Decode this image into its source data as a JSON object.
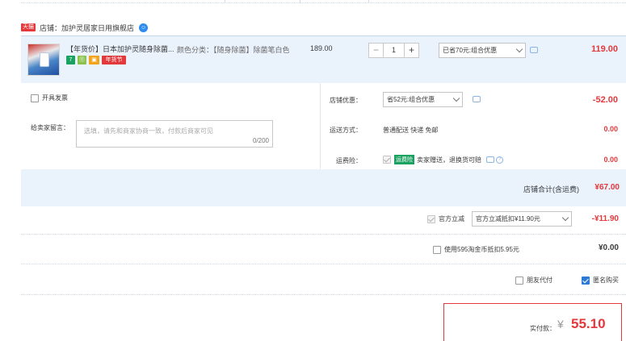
{
  "shop": {
    "tag": "天猫",
    "label": "店铺：加护灵居家日用旗舰店"
  },
  "item": {
    "title": "【年货价】日本加护灵随身除菌...",
    "icons": {
      "seven": "7",
      "leaf": "⑪",
      "card": "▣",
      "tag": "年货节"
    },
    "sku": "颜色分类：【随身除菌】除菌笔白色",
    "price": "189.00",
    "qty": "1",
    "minus": "−",
    "plus": "+",
    "discount_select": "已省70元:组合优惠",
    "total": "119.00"
  },
  "invoice": {
    "label": "开具发票"
  },
  "message": {
    "label": "给卖家留言：",
    "placeholder": "选填，请先和商家协商一致，付款后商家可见",
    "counter": "0/200"
  },
  "store_discount": {
    "label": "店铺优惠：",
    "select": "省52元:组合优惠",
    "amount": "-52.00"
  },
  "shipping": {
    "label": "运送方式：",
    "value": "普通配送 快递 免邮",
    "amount": "0.00"
  },
  "insurance": {
    "label": "运费险：",
    "tag": "运费险",
    "value": "卖家赠送，退换货可赔",
    "amount": "0.00"
  },
  "store_total": {
    "label": "店铺合计(含运费)",
    "amount": "¥67.00"
  },
  "official_discount": {
    "label": "官方立减",
    "select": "官方立减抵扣¥11.90元",
    "amount": "-¥11.90"
  },
  "taojinbi": {
    "label": "使用595淘金币抵扣5.95元",
    "amount": "¥0.00"
  },
  "options": {
    "friend_pay": "朋友代付",
    "anonymous": "匿名购买"
  },
  "pay": {
    "label": "实付款：",
    "currency": "¥",
    "amount": "55.10"
  },
  "colors": {
    "accent": "#e4393c",
    "row_bg": "#eaf2fc",
    "link_blue": "#2c7ad6"
  }
}
